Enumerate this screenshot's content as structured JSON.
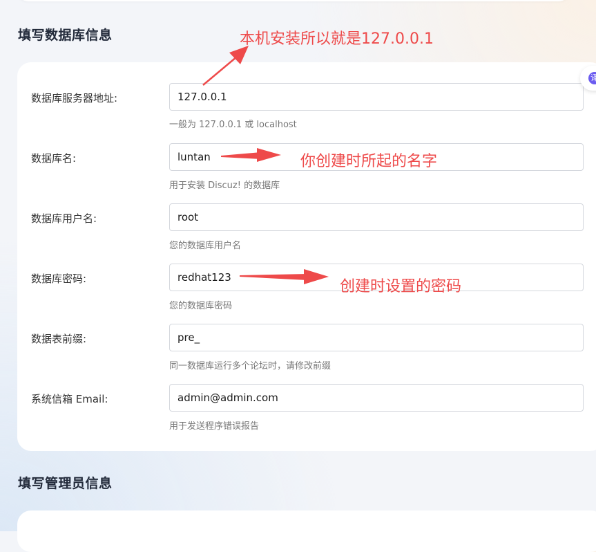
{
  "sections": {
    "database_title": "填写数据库信息",
    "admin_title": "填写管理员信息"
  },
  "fields": [
    {
      "label": "数据库服务器地址:",
      "value": "127.0.0.1",
      "hint": "一般为 127.0.0.1 或 localhost"
    },
    {
      "label": "数据库名:",
      "value": "luntan",
      "hint": "用于安装 Discuz! 的数据库"
    },
    {
      "label": "数据库用户名:",
      "value": "root",
      "hint": "您的数据库用户名"
    },
    {
      "label": "数据库密码:",
      "value": "redhat123",
      "hint": "您的数据库密码"
    },
    {
      "label": "数据表前缀:",
      "value": "pre_",
      "hint": "同一数据库运行多个论坛时，请修改前缀"
    },
    {
      "label": "系统信箱 Email:",
      "value": "admin@admin.com",
      "hint": "用于发送程序错误报告"
    }
  ],
  "annotations": {
    "server": "本机安装所以就是127.0.0.1",
    "dbname": "你创建时所起的名字",
    "password": "创建时设置的密码",
    "color": "#ee4a4a"
  },
  "side_widget": {
    "icon": "translate-icon",
    "glyph": "译"
  }
}
